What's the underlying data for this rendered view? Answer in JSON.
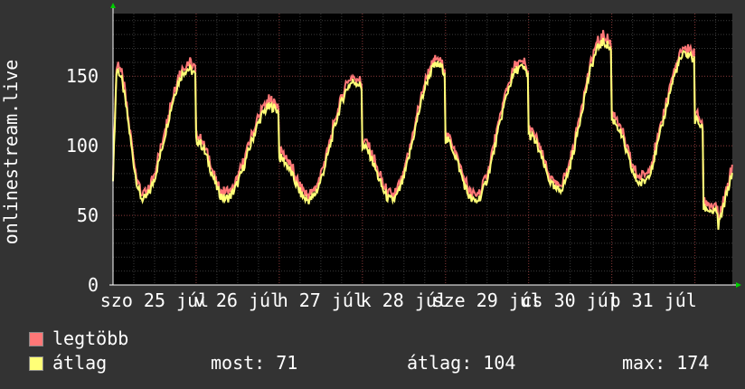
{
  "chart_data": {
    "type": "line",
    "ylabel": "onlinestream.live",
    "ylim": [
      0,
      195
    ],
    "yticks": [
      0,
      50,
      100,
      150
    ],
    "x_tick_labels": [
      "szo 25 júl",
      "v 26 júl",
      "h 27 júl",
      "k 28 júl",
      "sze 29 júl",
      "cs 30 júl",
      "p 31 júl"
    ],
    "x_days": 7.45,
    "series": [
      {
        "name": "legtöbb",
        "color": "#ff7777"
      },
      {
        "name": "átlag",
        "color": "#ffff77"
      }
    ],
    "daily_shape": {
      "min": [
        61,
        62,
        61,
        61,
        60,
        68,
        73
      ],
      "max": [
        155,
        128,
        146,
        158,
        156,
        174,
        166
      ],
      "end_value": 71
    }
  },
  "legend": {
    "max_label": "legtöbb",
    "avg_label": "átlag",
    "stats": {
      "current": "most: 71",
      "average": "átlag: 104",
      "maximum": "max: 174"
    }
  },
  "colors": {
    "background": "#333333",
    "plot": "#000000",
    "grid_major": "#8a3a3a",
    "grid_minor": "#3a3a3a",
    "max_line": "#ff7777",
    "avg_line": "#ffff77",
    "axis": "#ffffff",
    "arrow": "#00cc00"
  }
}
